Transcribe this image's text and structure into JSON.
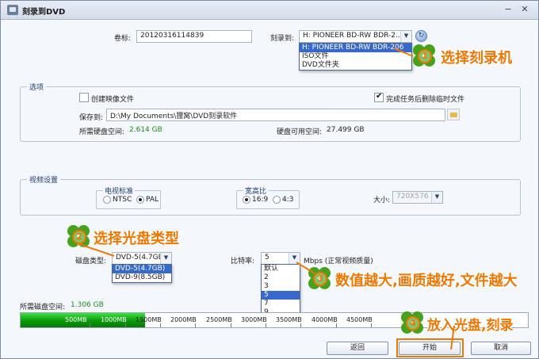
{
  "window": {
    "title": "刻录到DVD",
    "minimize_glyph": "−",
    "close_glyph": "✕"
  },
  "volume": {
    "label": "卷标:",
    "value": "20120316114839"
  },
  "burn_to": {
    "label": "刻录到:",
    "selected": "H: PIONEER  BD-RW   BDR-2...",
    "options": [
      "H: PIONEER  BD-RW   BDR-206",
      "ISO文件",
      "DVD文件夹"
    ],
    "selected_index": 0
  },
  "options_group": {
    "title": "选项",
    "create_image_label": "创建映像文件",
    "create_image_checked": false,
    "delete_temp_label": "完成任务后删除临时文件",
    "delete_temp_checked": true,
    "save_to_label": "保存到:",
    "save_to_value": "D:\\My Documents\\狸窝\\DVD刻录软件",
    "required_space_label": "所需硬盘空间:",
    "required_space_value": "2.614 GB",
    "available_space_label": "硬盘可用空间:",
    "available_space_value": "27.499 GB"
  },
  "video_group": {
    "title": "视频设置",
    "tv_standard_title": "电视标准",
    "ntsc_label": "NTSC",
    "pal_label": "PAL",
    "selected_standard": "PAL",
    "aspect_title": "宽高比",
    "aspect_169_label": "16:9",
    "aspect_43_label": "4:3",
    "selected_aspect": "16:9",
    "size_label": "大小:",
    "size_value": "720X576"
  },
  "disc_type": {
    "label": "磁盘类型:",
    "selected": "DVD-5(4.7GB)",
    "options": [
      "DVD-5(4.7GB)",
      "DVD-9(8.5GB)"
    ],
    "selected_index": 0
  },
  "bitrate": {
    "label": "比特率:",
    "selected": "5",
    "unit": "Mbps (正常视频质量)",
    "options": [
      "默认",
      "2",
      "3",
      "5",
      "7",
      "9"
    ],
    "selected_index": 3
  },
  "disc_space": {
    "label": "所需磁盘空间:",
    "value": "1.306 GB",
    "fill_fraction": 0.245,
    "scale_labels": [
      "500MB",
      "1000MB",
      "1500MB",
      "2000MB",
      "2500MB",
      "3000MB",
      "3500MB",
      "4000MB",
      "4500MB"
    ]
  },
  "buttons": {
    "back": "返回",
    "start": "开始",
    "cancel": "取消"
  },
  "annotations": {
    "step1_num": "1",
    "step1_text": "选择刻录机",
    "step2_num": "2",
    "step2_text": "选择光盘类型",
    "step3_num": "3",
    "step3_text": "数值越大,画质越好,文件越大",
    "step4_num": "4",
    "step4_text": "放入光盘,刻录"
  },
  "colors": {
    "annotation": "#ee7700",
    "capacity_green": "#0a9a0a",
    "selection_blue": "#3669c9"
  }
}
